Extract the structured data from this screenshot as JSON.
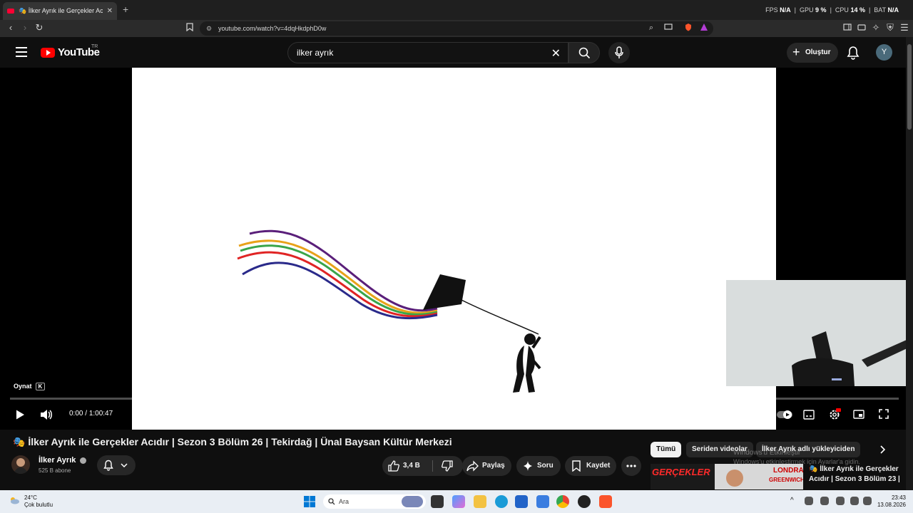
{
  "browser": {
    "tab_title": "🎭 İlker Ayrık ile Gerçekler Acıdır",
    "tab_close": "✕",
    "new_tab": "+",
    "url": "youtube.com/watch?v=4dqHkdphD0w",
    "perf": {
      "fps_label": "FPS",
      "fps_value": "N/A",
      "gpu_label": "GPU",
      "gpu_value": "9 %",
      "cpu_label": "CPU",
      "cpu_value": "14 %",
      "bat_label": "BAT",
      "bat_value": "N/A"
    }
  },
  "youtube": {
    "logo_text": "YouTube",
    "country_code": "TR",
    "search_query": "ilker ayrık",
    "create_label": "Oluştur",
    "avatar_letter": "Y"
  },
  "player": {
    "tooltip_label": "Oynat",
    "tooltip_key": "K",
    "current_time": "0:00",
    "duration": "1:00:47",
    "time_separator": " / ",
    "progress": 0.0
  },
  "video": {
    "title": "🎭 İlker Ayrık ile Gerçekler Acıdır | Sezon 3 Bölüm 26 | Tekirdağ | Ünal Baysan Kültür Merkezi",
    "channel_name": "İlker Ayrık",
    "subscribers": "525 B abone",
    "likes": "3,4 B",
    "share_label": "Paylaş",
    "ask_label": "Soru",
    "save_label": "Kaydet"
  },
  "sidebar": {
    "chips": [
      "Tümü",
      "Seriden videolar",
      "İlker Ayrık adlı yükleyiciden"
    ],
    "watermark_line1": "Windows'u Etkinleştir",
    "watermark_line2": "Windows'u etkinleştirmek için Ayarlar'a gidin.",
    "next_title": "🎭 İlker Ayrık ile Gerçekler Acıdır | Sezon 3 Bölüm 23 |",
    "next_thumb_text1": "GERÇEKLER",
    "next_thumb_text2": "LONDRA",
    "next_thumb_text3": "GREENWICH"
  },
  "taskbar": {
    "temperature": "24°C",
    "weather": "Çok bulutlu",
    "search_placeholder": "Ara",
    "time": "23:43",
    "date": "13.08.2026"
  },
  "colors": {
    "accent": "#ff0000",
    "yt_bg": "#0f0f0f",
    "chip_bg": "#272727"
  }
}
